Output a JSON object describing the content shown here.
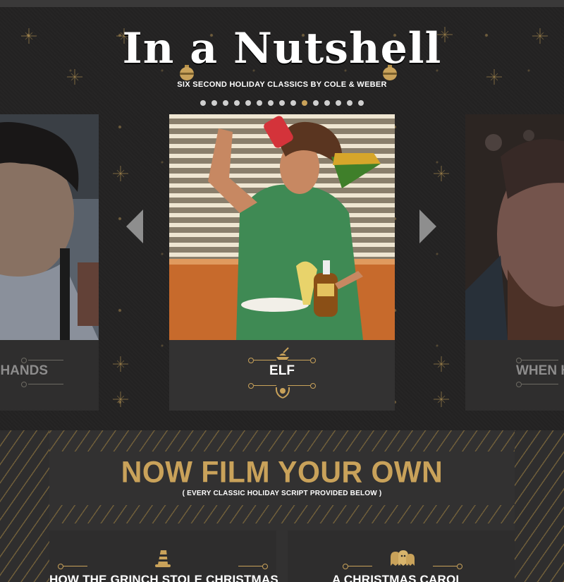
{
  "site": {
    "logo_title": "In a Nutshell",
    "subtitle": "SIX SECOND HOLIDAY CLASSICS BY COLE & WEBER",
    "carousel_dots": {
      "count": 15,
      "active_index": 9
    }
  },
  "carousel": {
    "prev_label": "previous-arrow",
    "next_label": "next-arrow",
    "slides": [
      {
        "title": "EDWARD SCISSORHANDS",
        "visible_title": "ORHANDS",
        "icon": "shears-icon"
      },
      {
        "title": "ELF",
        "visible_title": "ELF",
        "icon": "syrup-icon"
      },
      {
        "title": "WHEN HARRY MET SALLY",
        "visible_title": "WHEN HA",
        "icon": "heart-icon"
      }
    ]
  },
  "film_section": {
    "heading": "NOW FILM YOUR OWN",
    "subheading": "( EVERY CLASSIC HOLIDAY SCRIPT PROVIDED BELOW )",
    "scripts": [
      {
        "title": "HOW THE GRINCH STOLE CHRISTMAS",
        "icon": "striped-hat-icon"
      },
      {
        "title": "A CHRISTMAS CAROL",
        "icon": "ghosts-icon"
      }
    ]
  },
  "colors": {
    "gold": "#c9a25a",
    "background": "#2c2b2b",
    "panel": "#333232"
  }
}
